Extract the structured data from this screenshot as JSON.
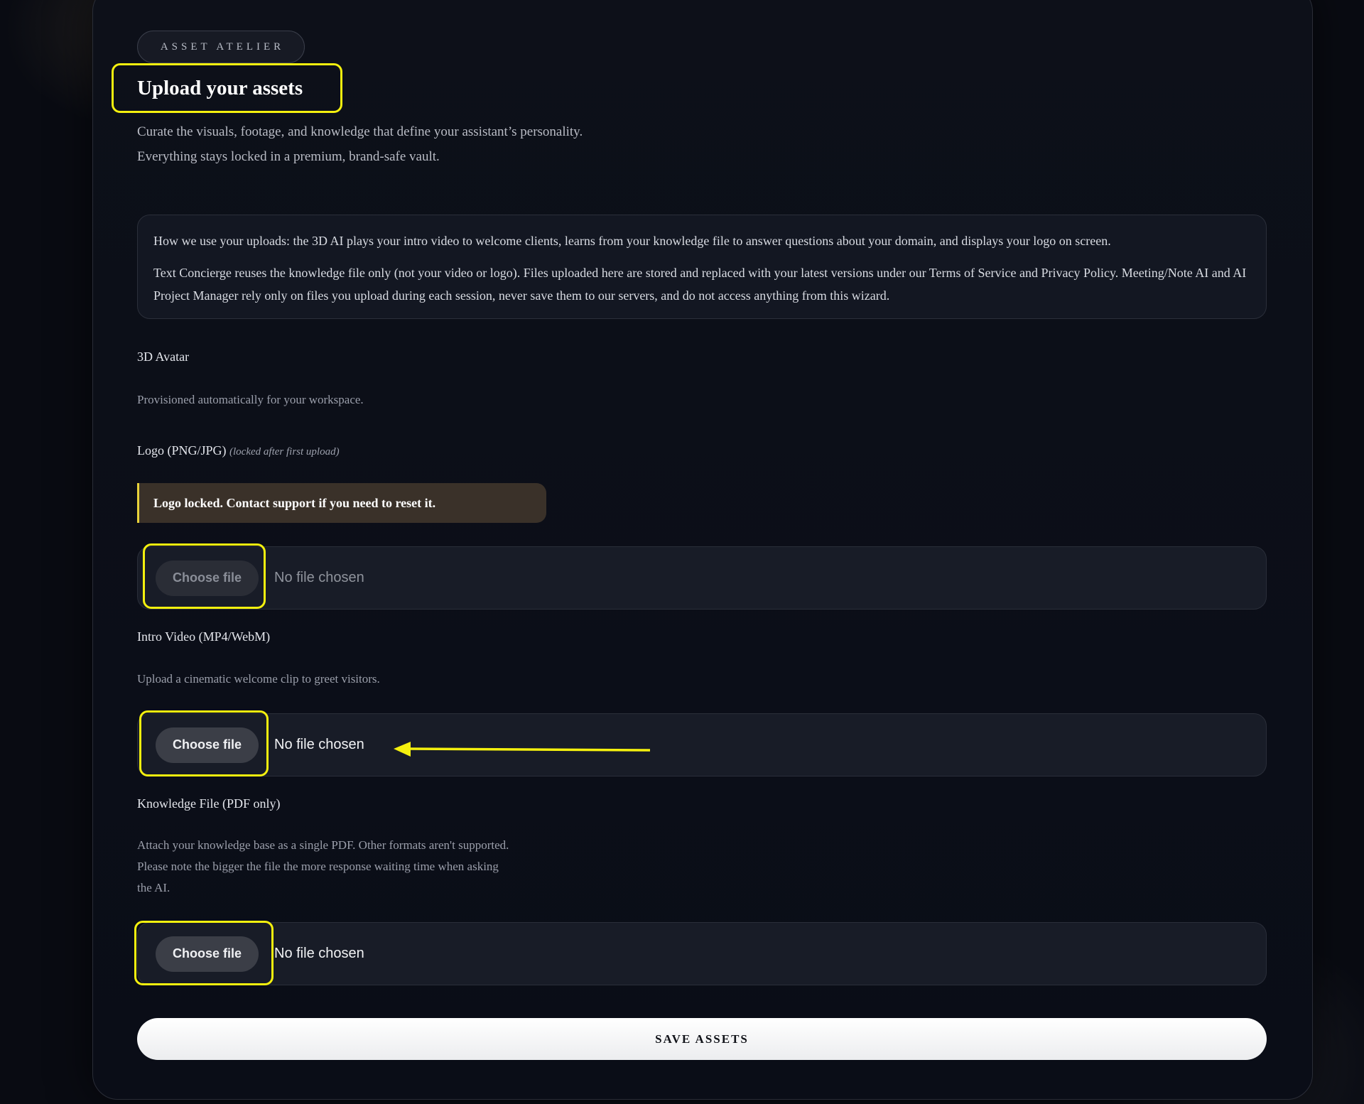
{
  "header": {
    "eyebrow": "ASSET ATELIER",
    "title": "Upload your assets",
    "subtitle_line1": "Curate the visuals, footage, and knowledge that define your assistant’s personality.",
    "subtitle_line2": "Everything stays locked in a premium, brand-safe vault."
  },
  "info": {
    "p1": "How we use your uploads: the 3D AI plays your intro video to welcome clients, learns from your knowledge file to answer questions about your domain, and displays your logo on screen.",
    "p2": "Text Concierge reuses the knowledge file only (not your video or logo). Files uploaded here are stored and replaced with your latest versions under our Terms of Service and Privacy Policy. Meeting/Note AI and AI Project Manager rely only on files you upload during each session, never save them to our servers, and do not access anything from this wizard."
  },
  "avatar": {
    "label": "3D Avatar",
    "help": "Provisioned automatically for your workspace."
  },
  "logo": {
    "label": "Logo (PNG/JPG)",
    "note": "(locked after first upload)",
    "locked_message": "Logo locked. Contact support if you need to reset it.",
    "button": "Choose file",
    "status": "No file chosen"
  },
  "video": {
    "label": "Intro Video (MP4/WebM)",
    "help": "Upload a cinematic welcome clip to greet visitors.",
    "button": "Choose file",
    "status": "No file chosen"
  },
  "knowledge": {
    "label": "Knowledge File (PDF only)",
    "help_line1": "Attach your knowledge base as a single PDF. Other formats aren't supported.",
    "help_line2": "Please note the bigger the file the more response waiting time when asking",
    "help_line3": "the AI.",
    "button": "Choose file",
    "status": "No file chosen"
  },
  "actions": {
    "save_label": "SAVE ASSETS"
  },
  "colors": {
    "highlight": "#f4f00e",
    "background": "#0a0c14",
    "locked_accent": "#e8d23a"
  }
}
